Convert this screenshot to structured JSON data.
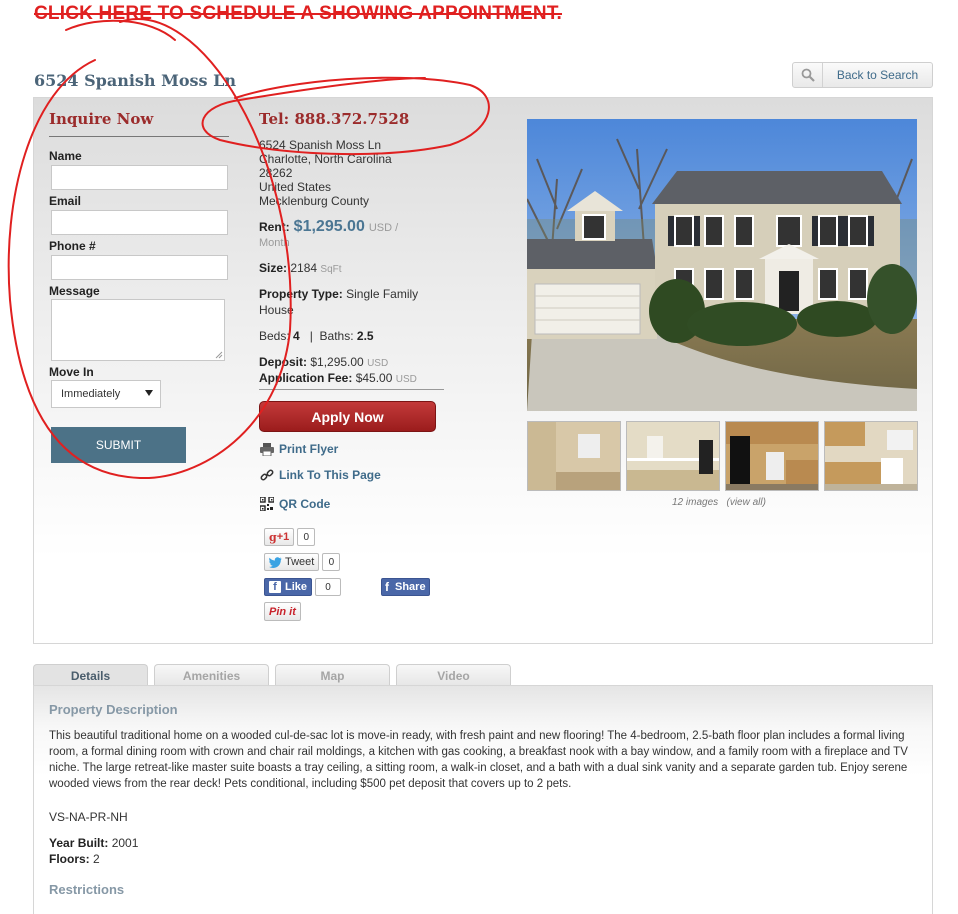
{
  "banner": {
    "text": "CLICK HERE TO SCHEDULE A SHOWING APPOINTMENT."
  },
  "property": {
    "title": "6524 Spanish Moss Ln"
  },
  "back_button": {
    "label": "Back to Search",
    "icon": "search-icon"
  },
  "inquire": {
    "title": "Inquire Now",
    "name_label": "Name",
    "email_label": "Email",
    "phone_label": "Phone #",
    "message_label": "Message",
    "move_in_label": "Move In",
    "move_in_value": "Immediately",
    "submit_label": "SUBMIT"
  },
  "info": {
    "tel": "Tel: 888.372.7528",
    "address": [
      "6524 Spanish Moss Ln",
      "Charlotte,  North Carolina",
      "28262",
      "United States",
      "Mecklenburg County"
    ],
    "rent_label": "Rent:",
    "rent_value": "$1,295.00",
    "rent_unit": "USD /",
    "rent_period": "Month",
    "size_label": "Size:",
    "size_value": "2184",
    "size_unit": "SqFt",
    "type_label": "Property Type:",
    "type_value_1": "Single Family",
    "type_value_2": "House",
    "beds_label": "Beds:",
    "beds_value": "4",
    "baths_sep": "|",
    "baths_label": "Baths:",
    "baths_value": "2.5",
    "deposit_label": "Deposit:",
    "deposit_value": "$1,295.00",
    "deposit_unit": "USD",
    "appfee_label": "Application Fee:",
    "appfee_value": "$45.00",
    "appfee_unit": "USD"
  },
  "actions": {
    "apply": "Apply Now",
    "print": "Print Flyer",
    "link": "Link To This Page",
    "qr": "QR Code"
  },
  "social": {
    "gplus_label": "+1",
    "gplus_count": "0",
    "tweet_label": "Tweet",
    "tweet_count": "0",
    "like_label": "Like",
    "like_count": "0",
    "share_label": "Share",
    "pin_label": "Pin it"
  },
  "gallery": {
    "count_text": "12 images",
    "view_all": "(view all)"
  },
  "tabs": [
    "Details",
    "Amenities",
    "Map",
    "Video"
  ],
  "details": {
    "desc_title": "Property Description",
    "description": "This beautiful traditional home on a wooded cul-de-sac lot is move-in ready, with fresh paint and new flooring! The 4-bedroom, 2.5-bath floor plan includes a formal living room, a formal dining room with crown and chair rail moldings, a kitchen with gas cooking, a breakfast nook with a bay window, and a family room with a fireplace and TV niche. The large retreat-like master suite boasts a tray ceiling, a sitting room, a walk-in closet, and a bath with a dual sink vanity and a separate garden tub. Enjoy serene wooded views from the rear deck! Pets conditional, including $500 pet deposit that covers up to 2 pets.",
    "code": "VS-NA-PR-NH",
    "year_label": "Year Built:",
    "year_value": "2001",
    "floors_label": "Floors:",
    "floors_value": "2",
    "restrictions_title": "Restrictions"
  },
  "colors": {
    "accent_red": "#9b2b2b",
    "link_blue": "#3f6b8a",
    "submit_blue": "#4c7287",
    "annotation": "#e02020"
  }
}
